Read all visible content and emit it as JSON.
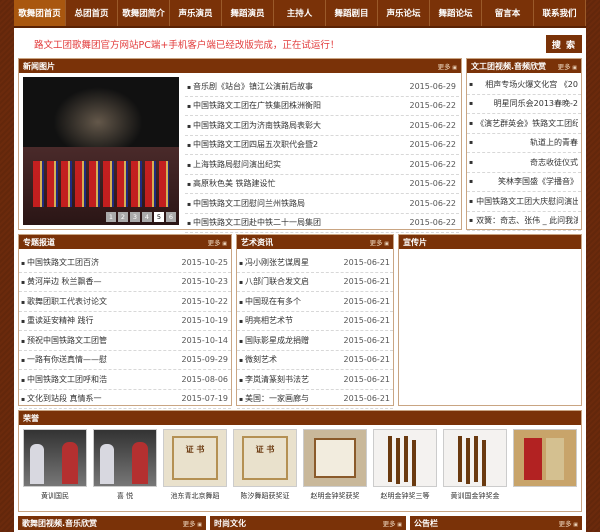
{
  "nav": [
    "歌舞团首页",
    "总团首页",
    "歌舞团简介",
    "声乐演员",
    "舞蹈演员",
    "主持人",
    "舞蹈剧目",
    "声乐论坛",
    "舞蹈论坛",
    "留言本",
    "联系我们"
  ],
  "notice": {
    "text": "路文工团歌舞团官方网站PC端+手机客户端已经改版完成，正在试运行！",
    "search_label": "搜 索"
  },
  "news": {
    "title": "新闻图片",
    "more": "更多",
    "pager": [
      "1",
      "2",
      "3",
      "4",
      "5",
      "6"
    ],
    "items": [
      {
        "t": "音乐剧《站台》镇江公演前后故事",
        "d": "2015-06-29"
      },
      {
        "t": "中国铁路文工团在广铁集团株洲衡阳",
        "d": "2015-06-22"
      },
      {
        "t": "中国铁路文工团为济南铁路局表彰大",
        "d": "2015-06-22"
      },
      {
        "t": "中国铁路文工团四届五次职代会暨2",
        "d": "2015-06-22"
      },
      {
        "t": "上海铁路局慰问演出纪实",
        "d": "2015-06-22"
      },
      {
        "t": "高原秋色美 铁路建设忙",
        "d": "2015-06-22"
      },
      {
        "t": "中国铁路文工团慰问兰州铁路局",
        "d": "2015-06-22"
      },
      {
        "t": "中国铁路文工团赴中铁二十一局集团",
        "d": "2015-06-22"
      }
    ]
  },
  "video": {
    "title": "文工团视频.音频欣赏",
    "more": "更多",
    "items": [
      "相声专场火爆文化宫 《20",
      "明星同乐会2013春晚-2",
      "《演艺群英会》铁路文工团纪",
      "轨道上的青春",
      "奇志收徒仪式",
      "笑林李国盛《学播音》",
      "中国铁路文工团大庆慰问演出",
      "双簧：奇志、张伟 _ 此问我演"
    ]
  },
  "special": {
    "title": "专题报道",
    "more": "更多",
    "items": [
      {
        "t": "中国铁路文工团百济",
        "d": "2015-10-25"
      },
      {
        "t": "黄河岸边 秋兰飘香—",
        "d": "2015-10-23"
      },
      {
        "t": "歌舞团职工代表讨论文",
        "d": "2015-10-22"
      },
      {
        "t": "重读延安精神 践行",
        "d": "2015-10-19"
      },
      {
        "t": "预祝中国铁路文工团管",
        "d": "2015-10-14"
      },
      {
        "t": "一路有你送真情——慰",
        "d": "2015-09-29"
      },
      {
        "t": "中国铁路文工团呼和浩",
        "d": "2015-08-06"
      },
      {
        "t": "文化到站段 真情系一",
        "d": "2015-07-19"
      }
    ]
  },
  "art": {
    "title": "艺术资讯",
    "more": "更多",
    "items": [
      {
        "t": "冯小刚张艺谋周星",
        "d": "2015-06-21"
      },
      {
        "t": "八部门联合发文启",
        "d": "2015-06-21"
      },
      {
        "t": "中国现在有多个",
        "d": "2015-06-21"
      },
      {
        "t": "明亮相艺术节",
        "d": "2015-06-21"
      },
      {
        "t": "国际影星成龙捐赠",
        "d": "2015-06-21"
      },
      {
        "t": "微刻艺术",
        "d": "2015-06-21"
      },
      {
        "t": "李岚清篆刻书法艺",
        "d": "2015-06-21"
      },
      {
        "t": "美国：一家画廊与",
        "d": "2015-06-21"
      }
    ]
  },
  "promo": {
    "title": "宣传片"
  },
  "honor": {
    "title": "荣誉",
    "items": [
      {
        "cap": "黄训国民",
        "kind": "people"
      },
      {
        "cap": "喜 悦",
        "kind": "people"
      },
      {
        "cap": "池东青北京舞蹈",
        "kind": "cert"
      },
      {
        "cap": "陈汐舞蹈获奖证",
        "kind": "cert"
      },
      {
        "cap": "赵明金钟奖获奖",
        "kind": "framed"
      },
      {
        "cap": "赵明金钟奖三等",
        "kind": "trophy"
      },
      {
        "cap": "黄训国金钟奖金",
        "kind": "trophy"
      },
      {
        "cap": "",
        "kind": "banner"
      }
    ]
  },
  "bottom": [
    {
      "title": "歌舞团视频.音乐欣赏",
      "more": "更多"
    },
    {
      "title": "时尚文化",
      "more": "更多"
    },
    {
      "title": "公告栏",
      "more": "更多"
    }
  ]
}
